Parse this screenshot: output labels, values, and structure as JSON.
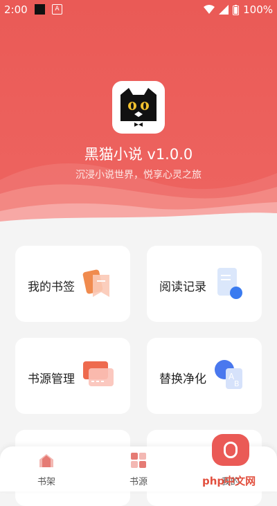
{
  "status_bar": {
    "time": "2:00",
    "battery": "100%"
  },
  "app": {
    "title": "黑猫小说 v1.0.0",
    "subtitle": "沉浸小说世界，悦享心灵之旅",
    "logo_icon": "black-cat-logo"
  },
  "menu": [
    {
      "label": "我的书签",
      "icon": "bookmark-icon"
    },
    {
      "label": "阅读记录",
      "icon": "reading-history-icon"
    },
    {
      "label": "书源管理",
      "icon": "source-manage-icon"
    },
    {
      "label": "替换净化",
      "icon": "replace-purify-icon"
    }
  ],
  "bottom_nav": [
    {
      "label": "书架",
      "icon": "bookshelf-icon"
    },
    {
      "label": "书源",
      "icon": "source-icon"
    },
    {
      "label": "我的",
      "icon": "profile-icon",
      "active": true
    }
  ],
  "watermark": "php中文网",
  "colors": {
    "primary": "#ea5a56",
    "background": "#f4f4f4"
  }
}
